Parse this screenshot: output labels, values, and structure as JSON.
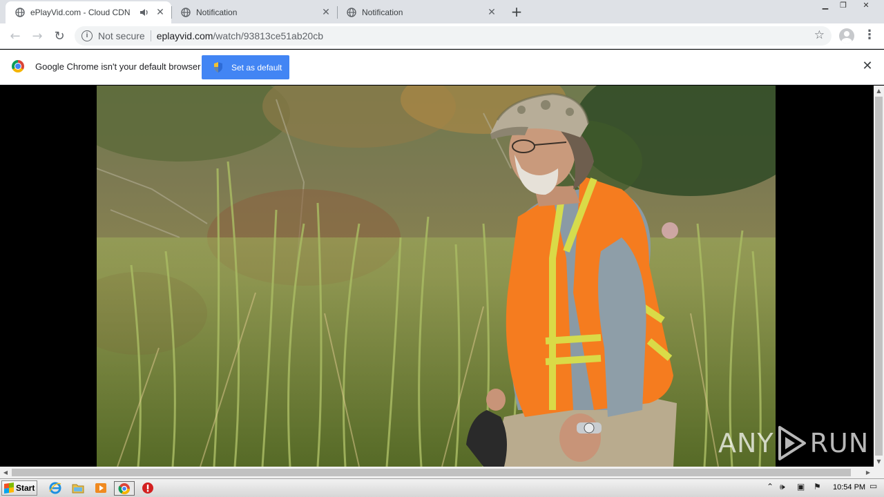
{
  "tabs": [
    {
      "title": "ePlayVid.com - Cloud CDN",
      "active": true,
      "audio": true
    },
    {
      "title": "Notification",
      "active": false,
      "audio": false
    },
    {
      "title": "Notification",
      "active": false,
      "audio": false
    }
  ],
  "omnibox": {
    "security_label": "Not secure",
    "host": "eplayvid.com",
    "path": "/watch/93813ce51ab20cb"
  },
  "infobar": {
    "message": "Google Chrome isn't your default browser",
    "button_label": "Set as default"
  },
  "watermark": {
    "left": "ANY",
    "right": "RUN"
  },
  "taskbar": {
    "start_label": "Start",
    "clock": "10:54 PM",
    "apps": [
      "internet-explorer-icon",
      "file-explorer-icon",
      "media-player-icon",
      "chrome-icon",
      "stop-icon"
    ]
  },
  "colors": {
    "accent": "#4285f4",
    "tabstrip": "#dee1e6",
    "vest": "#f57c1f"
  }
}
